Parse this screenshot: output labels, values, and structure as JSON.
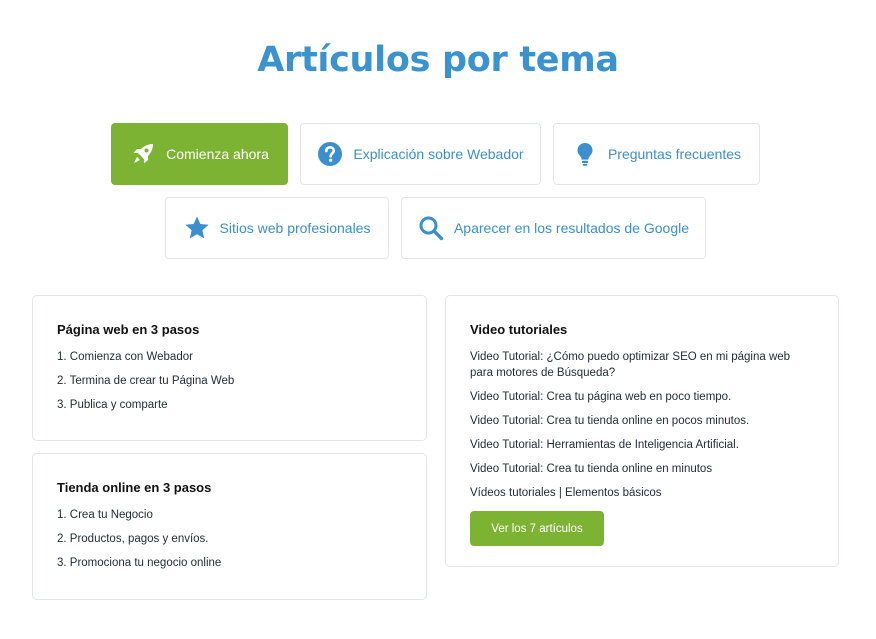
{
  "page": {
    "title": "Artículos por tema"
  },
  "topics": [
    {
      "label": "Comienza ahora",
      "icon": "rocket-icon",
      "active": true
    },
    {
      "label": "Explicación sobre Webador",
      "icon": "question-icon"
    },
    {
      "label": "Preguntas frecuentes",
      "icon": "lightbulb-icon"
    },
    {
      "label": "Sitios web profesionales",
      "icon": "star-icon"
    },
    {
      "label": "Aparecer en los resultados de Google",
      "icon": "search-icon"
    }
  ],
  "sections": {
    "web3": {
      "title": "Página web en 3 pasos",
      "items": [
        "1. Comienza con Webador",
        "2. Termina de crear tu Página Web",
        "3. Publica y comparte"
      ]
    },
    "store3": {
      "title": "Tienda online en 3 pasos",
      "items": [
        "1. Crea tu Negocio",
        "2. Productos, pagos y envíos.",
        "3. Promociona tu negocio online"
      ]
    },
    "videos": {
      "title": "Video tutoriales",
      "items": [
        "Video Tutorial: ¿Cómo puedo optimizar SEO en mi página web para motores de Búsqueda?",
        "Video Tutorial: Crea tu página web en poco tiempo.",
        "Video Tutorial: Crea tu tienda online en pocos minutos.",
        "Video Tutorial: Herramientas de Inteligencia Artificial.",
        "Video Tutorial: Crea tu tienda online en minutos",
        "Vídeos tutoriales | Elementos básicos"
      ],
      "more_label": "Ver los 7 artículos"
    }
  },
  "colors": {
    "accent_blue": "#3a92cf",
    "accent_green": "#7db333",
    "border": "#e2e6ea"
  }
}
